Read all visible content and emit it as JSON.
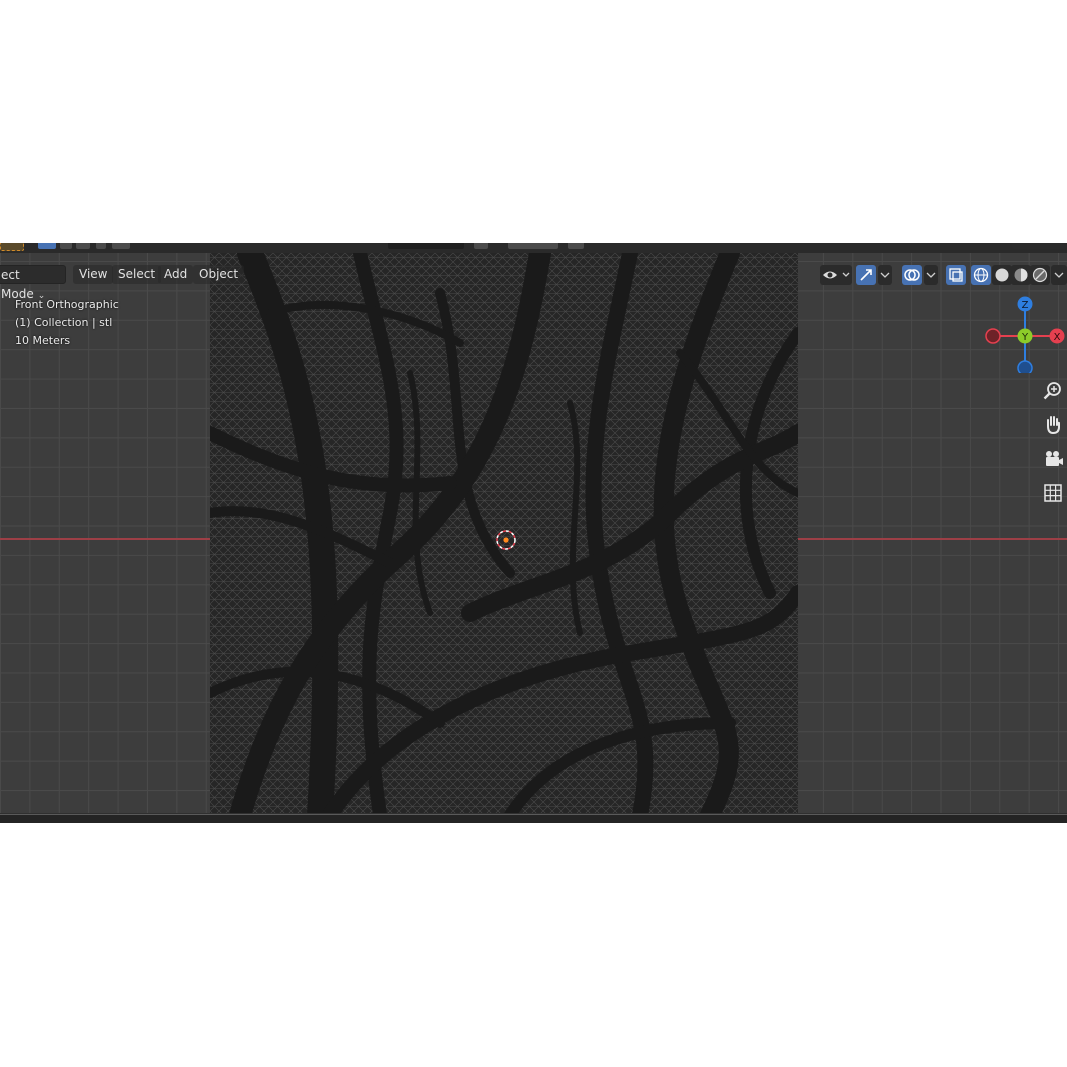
{
  "header": {
    "mode_label": "ect Mode",
    "menu": [
      "View",
      "Select",
      "Add",
      "Object"
    ]
  },
  "overlay": {
    "view_name": "Front Orthographic",
    "collection": "(1) Collection | stl",
    "scale": "10 Meters"
  },
  "gizmo": {
    "z_label": "Z",
    "y_label": "Y",
    "x_label": "X"
  },
  "colors": {
    "axis_x": "#e5404f",
    "axis_y": "#8ccc29",
    "axis_z": "#2e7ee0",
    "accent_blue": "#4772b3",
    "cursor_orange": "#ff8a1f"
  },
  "icons": {
    "visibility": "eye-icon",
    "gizmo_toggle": "arrow-gizmo-icon",
    "overlay_toggle": "overlay-icon",
    "xray": "xray-icon",
    "shading": [
      "wireframe-shading-icon",
      "solid-shading-icon",
      "material-shading-icon",
      "rendered-shading-icon"
    ],
    "navigation": [
      "zoom-icon",
      "hand-pan-icon",
      "camera-icon",
      "grid-ortho-icon"
    ]
  }
}
